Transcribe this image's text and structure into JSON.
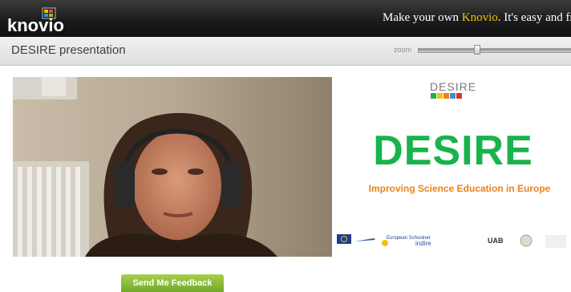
{
  "header": {
    "logo_text": "knovio",
    "tagline_prefix": "Make your own ",
    "tagline_brand": "Knovio",
    "tagline_suffix": ". It's easy and fre"
  },
  "presentation": {
    "title": "DESIRE presentation",
    "zoom_label": "zoom",
    "zoom_level": 0.38
  },
  "slide": {
    "header": "DESIRE",
    "title": "DESIRE",
    "subtitle": "Improving Science Education in Europe",
    "partner_texts": [
      "European Schoolnet",
      "UAB"
    ]
  },
  "feedback": {
    "label": "Send Me Feedback"
  },
  "colors": {
    "topbar": "#1c1c1c",
    "brand_yellow": "#f2c200",
    "slide_green": "#19b34b",
    "slide_orange": "#e8821e",
    "button_green": "#8dbd3a"
  }
}
